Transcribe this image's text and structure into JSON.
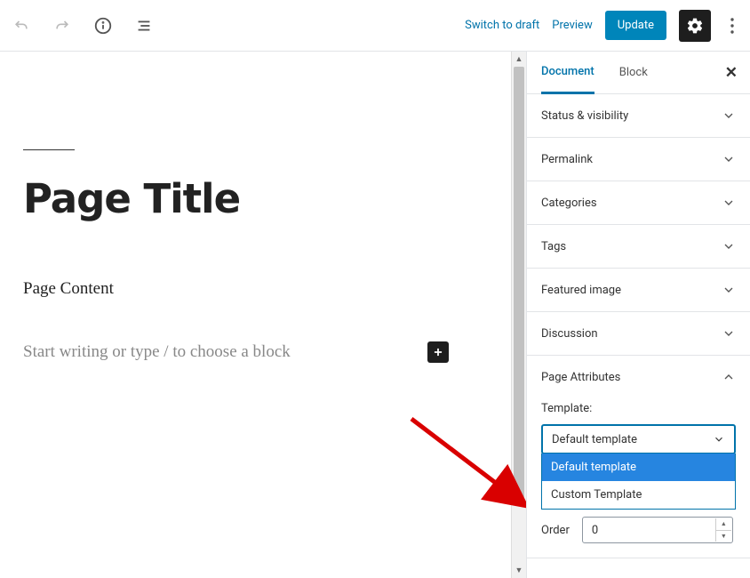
{
  "topbar": {
    "switch_to_draft": "Switch to draft",
    "preview": "Preview",
    "update": "Update"
  },
  "editor": {
    "title": "Page Title",
    "content": "Page Content",
    "block_placeholder": "Start writing or type / to choose a block"
  },
  "sidebar": {
    "tabs": {
      "document": "Document",
      "block": "Block"
    },
    "panels": {
      "status_visibility": "Status & visibility",
      "permalink": "Permalink",
      "categories": "Categories",
      "tags": "Tags",
      "featured_image": "Featured image",
      "discussion": "Discussion",
      "page_attributes": "Page Attributes"
    },
    "template": {
      "label": "Template:",
      "selected": "Default template",
      "options": [
        "Default template",
        "Custom Template"
      ]
    },
    "order": {
      "label": "Order",
      "value": "0"
    }
  }
}
